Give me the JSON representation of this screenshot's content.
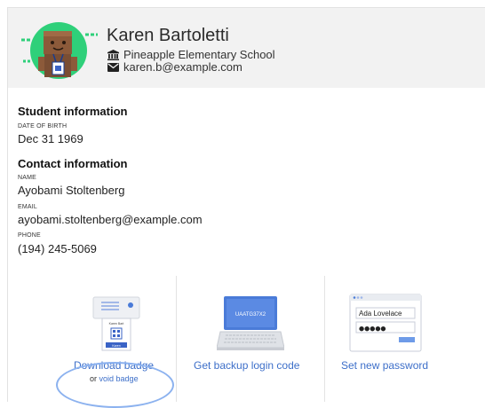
{
  "profile": {
    "name": "Karen Bartoletti",
    "school": "Pineapple Elementary School",
    "email": "karen.b@example.com"
  },
  "student_info": {
    "title": "Student information",
    "dob_label": "DATE OF BIRTH",
    "dob_value": "Dec 31 1969"
  },
  "contact_info": {
    "title": "Contact information",
    "name_label": "NAME",
    "name_value": "Ayobami Stoltenberg",
    "email_label": "EMAIL",
    "email_value": "ayobami.stoltenberg@example.com",
    "phone_label": "PHONE",
    "phone_value": "(194) 245-5069"
  },
  "actions": {
    "download_badge": "Download badge",
    "void_prefix": "or",
    "void_badge": "void badge",
    "badge_card_label": "Karen Bart",
    "badge_card_tag": "Karen",
    "backup_code": "Get backup login code",
    "laptop_code": "UAATG37X2",
    "set_password": "Set new password",
    "password_name": "Ada Lovelace",
    "password_dots": "●●●●●"
  },
  "colors": {
    "accent_link": "#3d6fc9",
    "avatar_green": "#2fd07a",
    "highlight_ellipse": "#8cb2ef"
  },
  "icons": {
    "school": "school-building-icon",
    "email": "envelope-icon"
  }
}
